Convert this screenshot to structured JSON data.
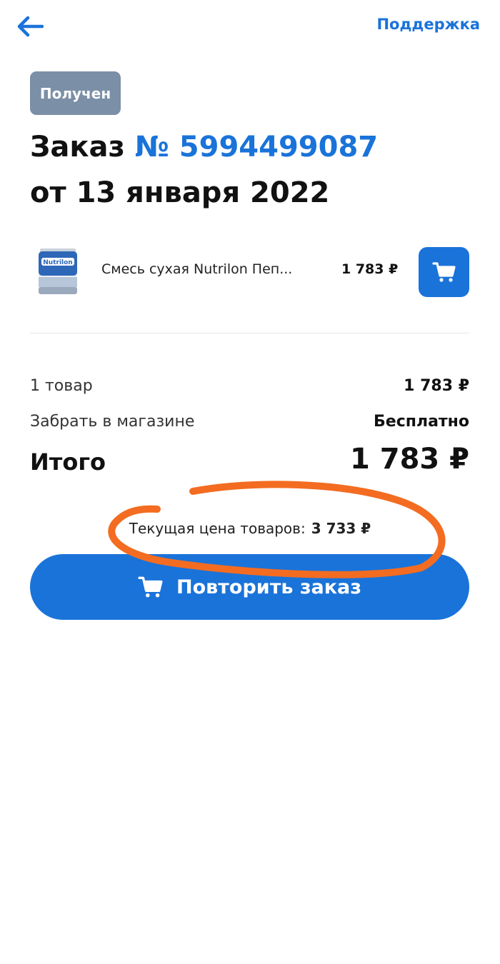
{
  "header": {
    "back_icon": "arrow-left-icon",
    "support_label": "Поддержка"
  },
  "order": {
    "status": "Получен",
    "title_prefix": "Заказ",
    "number": "№ 5994499087",
    "date": "от 13 января 2022"
  },
  "items": [
    {
      "image_icon": "product-can-image",
      "brand_text": "Nutrilon",
      "name": "Смесь сухая Nutrilon Пеп...",
      "price": "1 783 ₽",
      "cart_icon": "cart-icon"
    }
  ],
  "summary": {
    "items_count_label": "1 товар",
    "items_total": "1 783 ₽",
    "delivery_label": "Забрать в магазине",
    "delivery_value": "Бесплатно",
    "total_label": "Итого",
    "total_value": "1 783 ₽"
  },
  "current_price": {
    "label": "Текущая цена товаров:",
    "value": "3 733 ₽"
  },
  "repeat_button": {
    "label": "Повторить заказ",
    "icon": "cart-icon"
  },
  "colors": {
    "accent": "#1a73d9",
    "status_badge": "#7b8fa6",
    "annotation": "#f36c21"
  }
}
